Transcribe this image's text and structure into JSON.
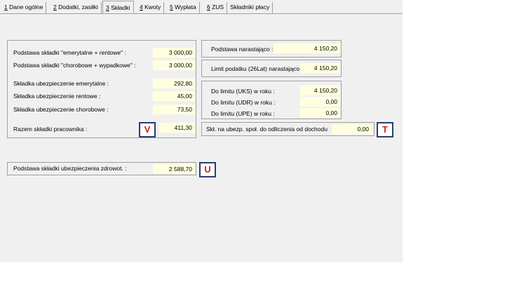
{
  "tabs": [
    {
      "num": "1",
      "label": " Dane ogólne"
    },
    {
      "num": "2",
      "label": " Dodatki, zasiłki"
    },
    {
      "num": "3",
      "label": " Składki"
    },
    {
      "num": "4",
      "label": " Kwoty"
    },
    {
      "num": "5",
      "label": " Wypłata"
    },
    {
      "num": "6",
      "label": " ZUS"
    },
    {
      "num": "",
      "label": "Składniki płacy"
    }
  ],
  "left": {
    "emer_rent_label": "Podstawa składki  \"emerytalne + rentowe\" :",
    "emer_rent_value": "3 000,00",
    "chor_wyp_label": "Podstawa składki  \"chorobowe + wypadkowe\" :",
    "chor_wyp_value": "3 000,00",
    "emer_label": "Składka ubezpieczenie emerytalne :",
    "emer_value": "292,80",
    "rent_label": "Składka ubezpieczenie rentowe :",
    "rent_value": "45,00",
    "chor_label": "Składka ubezpieczenie chorobowe :",
    "chor_value": "73,50",
    "razem_label": "Razem składki pracownika :",
    "razem_value": "411,30"
  },
  "health": {
    "label": "Podstawa składki ubezpieczenia zdrowot.  :",
    "value": "2 588,70"
  },
  "right": {
    "narast_label": "Podstawa narastająco :",
    "narast_value": "4 150,20",
    "limit_label": "Limit podatku (26Lat) narastająco :",
    "limit_value": "4 150,20",
    "uks_label": "Do limitu  (UKS) w roku :",
    "uks_value": "4 150,20",
    "udr_label": "Do limitu  (UDR) w roku :",
    "udr_value": "0,00",
    "upe_label": "Do limitu  (UPE) w roku :",
    "upe_value": "0,00",
    "odl_label": "Skł. na ubezp. społ. do odliczenia od dochodu",
    "odl_value": "0,00"
  },
  "markers": {
    "v": "V",
    "t": "T",
    "u": "U"
  }
}
